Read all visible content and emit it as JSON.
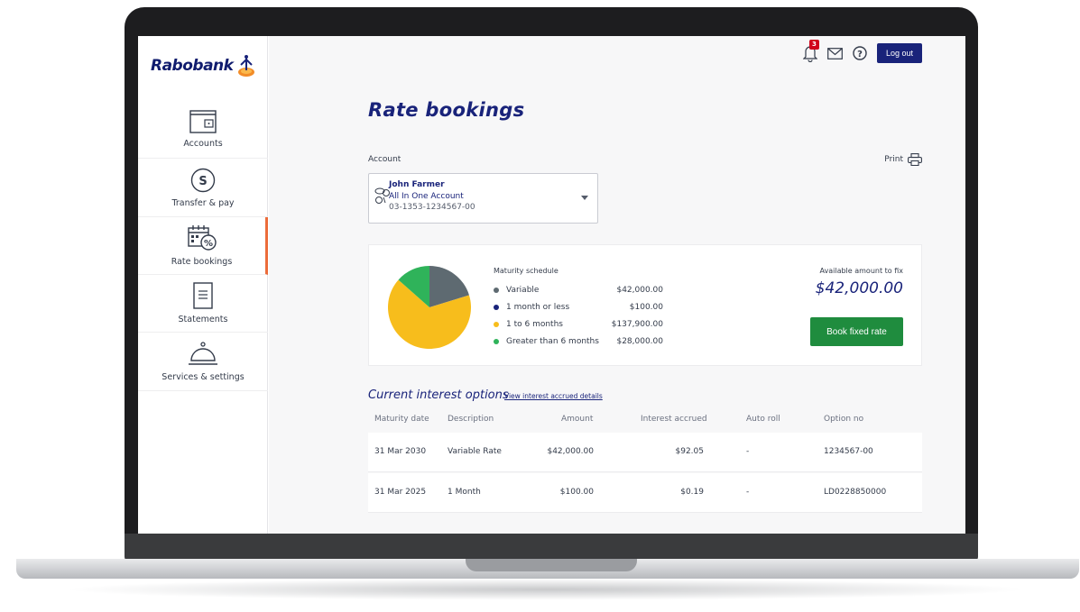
{
  "brand": {
    "name": "Rabobank"
  },
  "sidebar": {
    "items": [
      {
        "label": "Accounts",
        "icon": "wallet-icon"
      },
      {
        "label": "Transfer & pay",
        "icon": "dollar-circle-icon"
      },
      {
        "label": "Rate bookings",
        "icon": "calendar-percent-icon",
        "active": true
      },
      {
        "label": "Statements",
        "icon": "document-icon"
      },
      {
        "label": "Services & settings",
        "icon": "service-bell-icon"
      }
    ]
  },
  "topbar": {
    "notification_count": "3",
    "logout_label": "Log out"
  },
  "page": {
    "title": "Rate bookings",
    "account_label": "Account",
    "print_label": "Print"
  },
  "account": {
    "name": "John Farmer",
    "type": "All In One Account",
    "number": "03-1353-1234567-00"
  },
  "maturity": {
    "title": "Maturity schedule",
    "rows": [
      {
        "label": "Variable",
        "value": "$42,000.00",
        "color": "#5e6a71"
      },
      {
        "label": "1 month or less",
        "value": "$100.00",
        "color": "#19237a"
      },
      {
        "label": "1 to 6 months",
        "value": "$137,900.00",
        "color": "#f7bd1c"
      },
      {
        "label": "Greater than 6 months",
        "value": "$28,000.00",
        "color": "#2fb35a"
      }
    ],
    "available_label": "Available amount to fix",
    "available_amount": "$42,000.00",
    "book_button": "Book fixed rate"
  },
  "options": {
    "title": "Current interest options",
    "link": "View interest accrued details",
    "columns": [
      "Maturity date",
      "Description",
      "Amount",
      "Interest accrued",
      "Auto roll",
      "Option no"
    ],
    "rows": [
      [
        "31 Mar 2030",
        "Variable Rate",
        "$42,000.00",
        "$92.05",
        "-",
        "1234567-00"
      ],
      [
        "31 Mar 2025",
        "1 Month",
        "$100.00",
        "$0.19",
        "-",
        "LD0228850000"
      ]
    ]
  }
}
